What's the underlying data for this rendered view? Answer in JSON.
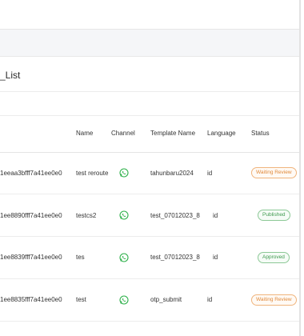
{
  "page": {
    "title_fragment": "_List"
  },
  "table": {
    "headers": {
      "id": "",
      "name": "Name",
      "channel": "Channel",
      "template_name": "Template Name",
      "language": "Language",
      "status": "Status"
    },
    "rows": [
      {
        "id": "1eeaa3bfff7a41ee0e0",
        "name": "test reroute",
        "channel_icon": "whatsapp-icon",
        "template": "tahunbaru2024",
        "language": "id",
        "status": "Waiting Review"
      },
      {
        "id": "1ee8890fff7a41ee0e0",
        "name": "testcs2",
        "channel_icon": "whatsapp-icon",
        "template": "test_07012023_8",
        "language": "id",
        "status": "Published"
      },
      {
        "id": "1ee8839fff7a41ee0e0",
        "name": "tes",
        "channel_icon": "whatsapp-icon",
        "template": "test_07012023_8",
        "language": "id",
        "status": "Approved"
      },
      {
        "id": "1ee8835fff7a41ee0e0",
        "name": "test",
        "channel_icon": "whatsapp-icon",
        "template": "otp_submit",
        "language": "id",
        "status": "Waiting Review"
      }
    ]
  },
  "colors": {
    "whatsapp_green": "#2fb14b",
    "status_waiting": "#e0893a",
    "status_published": "#3f9a4f"
  }
}
